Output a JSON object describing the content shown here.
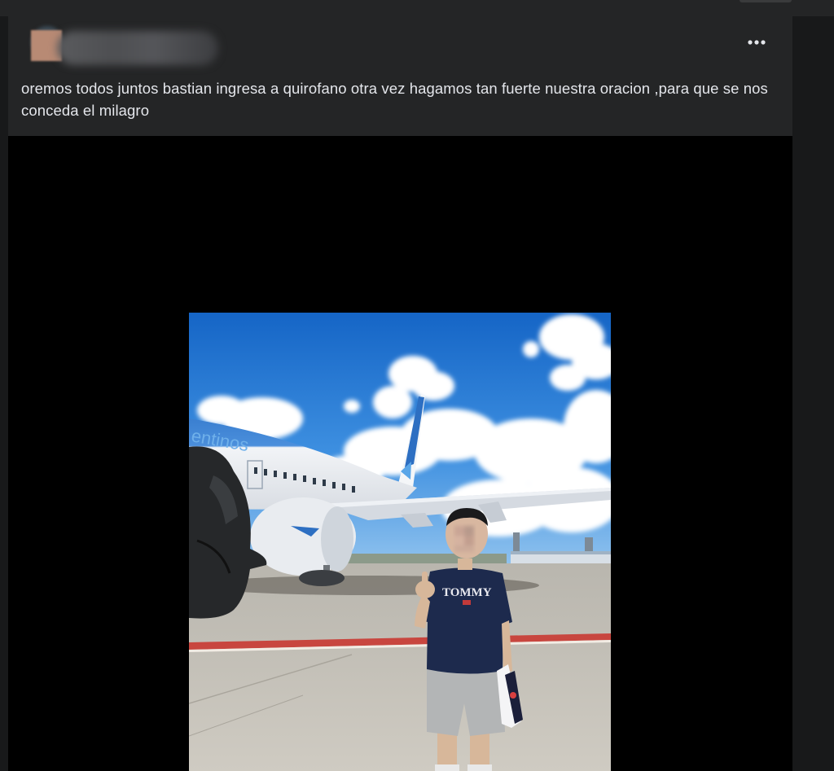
{
  "post": {
    "text": "oremos todos juntos bastian ingresa a quirofano otra vez hagamos tan fuerte nuestra oracion ,para que se nos conceda el milagro",
    "more_icon": "more-horizontal-icon",
    "photo": {
      "airline_livery_text": "entinos",
      "shirt_text": "TOMMY"
    }
  },
  "colors": {
    "page_background": "#18191a",
    "card_background": "#242526",
    "text_primary": "#e4e6eb",
    "media_background": "#000000"
  }
}
